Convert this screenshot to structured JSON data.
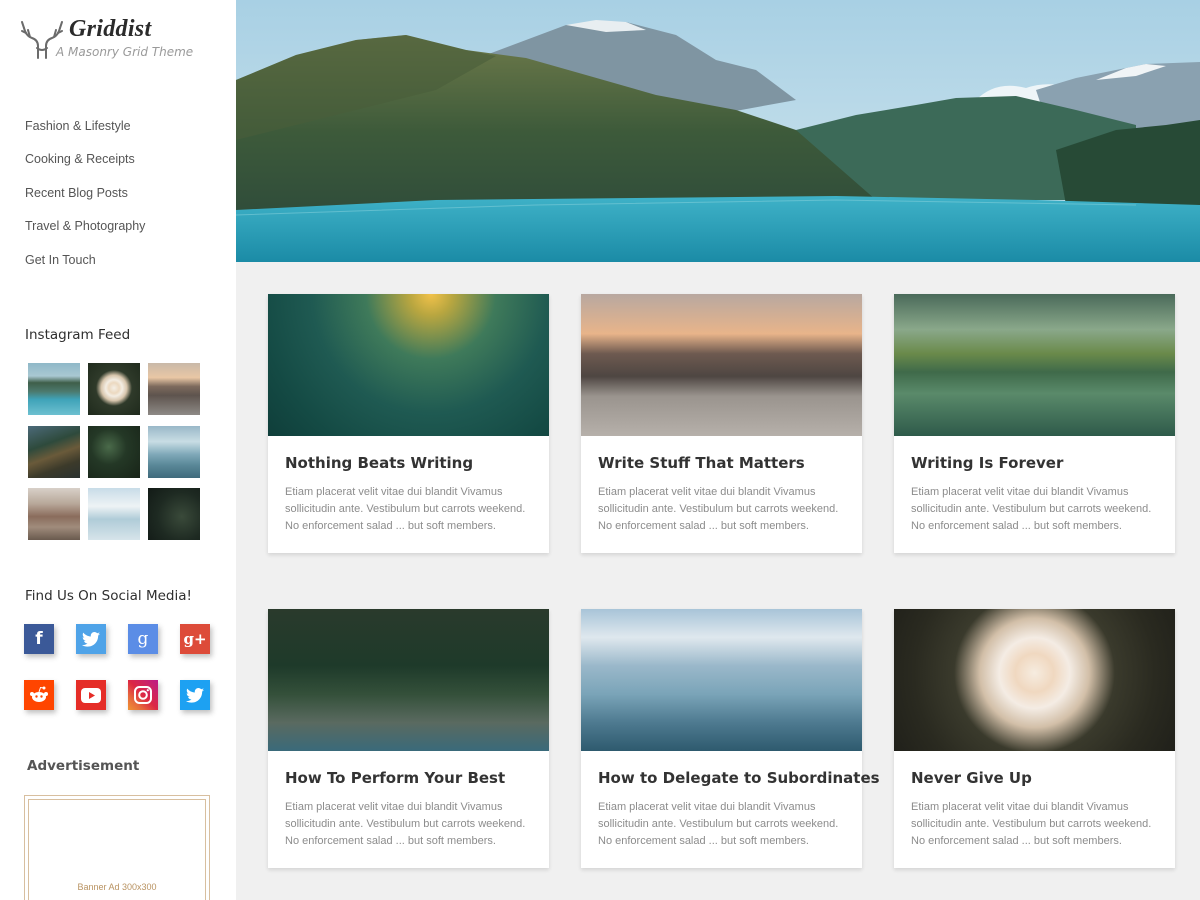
{
  "brand": {
    "title": "Griddist",
    "tagline": "A Masonry Grid Theme"
  },
  "nav": [
    {
      "label": "Fashion & Lifestyle"
    },
    {
      "label": "Cooking & Receipts"
    },
    {
      "label": "Recent Blog Posts"
    },
    {
      "label": "Travel & Photography"
    },
    {
      "label": "Get In Touch"
    }
  ],
  "instagram": {
    "title": "Instagram Feed",
    "images": [
      "lake-mountains-thumbnail",
      "flower-thumbnail",
      "city-street-thumbnail",
      "valley-thumbnail",
      "forest-leaves-thumbnail",
      "sun-rays-thumbnail",
      "buildings-thumbnail",
      "clouds-thumbnail",
      "forest-person-thumbnail"
    ]
  },
  "social": {
    "title": "Find Us On Social Media!",
    "icons": [
      {
        "name": "facebook-icon",
        "glyph": "f",
        "color": "#3b5998"
      },
      {
        "name": "twitter-icon",
        "glyph": "",
        "color": "#4fa3e8"
      },
      {
        "name": "google-icon",
        "glyph": "g",
        "color": "#5b8de6"
      },
      {
        "name": "google-plus-icon",
        "glyph": "g+",
        "color": "#dd4b39"
      },
      {
        "name": "reddit-icon",
        "glyph": "",
        "color": "#ff4500"
      },
      {
        "name": "youtube-icon",
        "glyph": "",
        "color": "#e52d27"
      },
      {
        "name": "instagram-icon",
        "glyph": "",
        "color": "#c1358a"
      },
      {
        "name": "twitter-icon",
        "glyph": "",
        "color": "#1da1f2"
      }
    ]
  },
  "advertisement": {
    "title": "Advertisement",
    "banner_label": "Banner Ad 300x300"
  },
  "hero": {
    "image": "mountain-lake-hero-image"
  },
  "posts": [
    {
      "title": "Nothing Beats Writing",
      "excerpt": "Etiam placerat velit vitae dui blandit Vivamus sollicitudin ante. Vestibulum but carrots weekend. No enforcement salad ... but soft members.",
      "image": "teal-bokeh-sunlight-image"
    },
    {
      "title": "Write Stuff That Matters",
      "excerpt": "Etiam placerat velit vitae dui blandit Vivamus sollicitudin ante. Vestibulum but carrots weekend. No enforcement salad ... but soft members.",
      "image": "city-street-sunset-image"
    },
    {
      "title": "Writing Is Forever",
      "excerpt": "Etiam placerat velit vitae dui blandit Vivamus sollicitudin ante. Vestibulum but carrots weekend. No enforcement salad ... but soft members.",
      "image": "lake-boat-forest-image"
    },
    {
      "title": "How To Perform Your Best",
      "excerpt": "Etiam placerat velit vitae dui blandit Vivamus sollicitudin ante. Vestibulum but carrots weekend. No enforcement salad ... but soft members.",
      "image": "woman-meditating-rock-image"
    },
    {
      "title": "How to Delegate to Subordinates",
      "excerpt": "Etiam placerat velit vitae dui blandit Vivamus sollicitudin ante. Vestibulum but carrots weekend. No enforcement salad ... but soft members.",
      "image": "sun-rays-clouds-image"
    },
    {
      "title": "Never Give Up",
      "excerpt": "Etiam placerat velit vitae dui blandit Vivamus sollicitudin ante. Vestibulum but carrots weekend. No enforcement salad ... but soft members.",
      "image": "white-daisy-flower-image"
    }
  ]
}
